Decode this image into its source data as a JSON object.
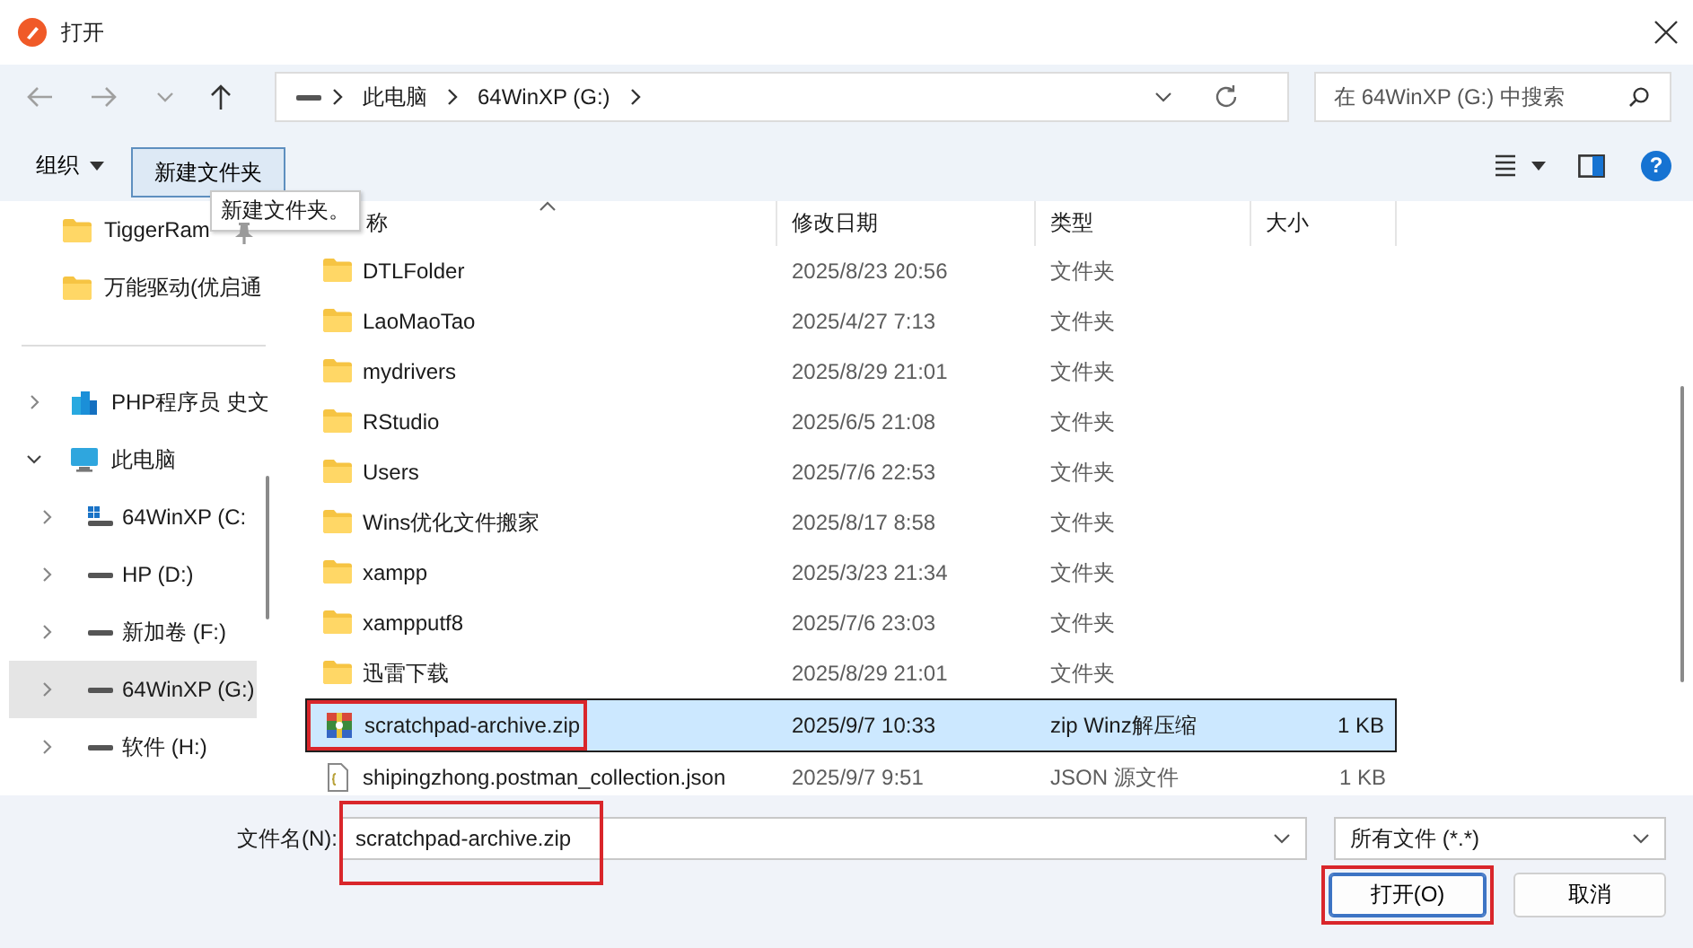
{
  "window": {
    "title": "打开"
  },
  "navigation": {
    "path": [
      "此电脑",
      "64WinXP (G:)"
    ],
    "search": {
      "placeholder": "在 64WinXP (G:) 中搜索"
    }
  },
  "toolbar": {
    "organize": "组织",
    "new_folder": {
      "label": "新建文件夹",
      "hovered": true
    },
    "tooltip": "新建文件夹。",
    "help": "?"
  },
  "sidebar": {
    "quick_access": [
      {
        "label": "TiggerRam",
        "pinned": true
      },
      {
        "label": "万能驱动(优启通",
        "pinned": false
      }
    ],
    "tree": [
      {
        "label": "PHP程序员 史文",
        "kind": "cloud",
        "expanded": false,
        "selected": false
      },
      {
        "label": "此电脑",
        "kind": "pc",
        "expanded": true,
        "selected": false,
        "children": [
          {
            "label": "64WinXP  (C:",
            "kind": "system",
            "expanded": false,
            "selected": false
          },
          {
            "label": "HP (D:)",
            "kind": "drive",
            "expanded": false,
            "selected": false
          },
          {
            "label": "新加卷 (F:)",
            "kind": "drive",
            "expanded": false,
            "selected": false
          },
          {
            "label": "64WinXP (G:)",
            "kind": "drive",
            "expanded": false,
            "selected": true
          },
          {
            "label": "软件 (H:)",
            "kind": "drive",
            "expanded": false,
            "selected": false
          }
        ]
      }
    ]
  },
  "file_list": {
    "columns": [
      {
        "label": "称",
        "sorted": true
      },
      {
        "label": "修改日期",
        "sorted": false
      },
      {
        "label": "类型",
        "sorted": false
      },
      {
        "label": "大小",
        "sorted": false
      }
    ],
    "rows": [
      {
        "name": "DTLFolder",
        "modified": "2025/8/23 20:56",
        "type": "文件夹",
        "kind": "folder",
        "selected": false,
        "highlighted": false
      },
      {
        "name": "LaoMaoTao",
        "modified": "2025/4/27 7:13",
        "type": "文件夹",
        "kind": "folder",
        "selected": false,
        "highlighted": false
      },
      {
        "name": "mydrivers",
        "modified": "2025/8/29 21:01",
        "type": "文件夹",
        "kind": "folder",
        "selected": false,
        "highlighted": false
      },
      {
        "name": "RStudio",
        "modified": "2025/6/5 21:08",
        "type": "文件夹",
        "kind": "folder",
        "selected": false,
        "highlighted": false
      },
      {
        "name": "Users",
        "modified": "2025/7/6 22:53",
        "type": "文件夹",
        "kind": "folder",
        "selected": false,
        "highlighted": false
      },
      {
        "name": "Wins优化文件搬家",
        "modified": "2025/8/17 8:58",
        "type": "文件夹",
        "kind": "folder",
        "selected": false,
        "highlighted": false
      },
      {
        "name": "xampp",
        "modified": "2025/3/23 21:34",
        "type": "文件夹",
        "kind": "folder",
        "selected": false,
        "highlighted": false
      },
      {
        "name": "xampputf8",
        "modified": "2025/7/6 23:03",
        "type": "文件夹",
        "kind": "folder",
        "selected": false,
        "highlighted": false
      },
      {
        "name": "迅雷下载",
        "modified": "2025/8/29 21:01",
        "type": "文件夹",
        "kind": "folder",
        "selected": false,
        "highlighted": false
      },
      {
        "name": "scratchpad-archive.zip",
        "modified": "2025/9/7 10:33",
        "type": "zip Winz解压缩",
        "size": "1 KB",
        "kind": "archive",
        "selected": true,
        "highlighted": true
      },
      {
        "name": "shipingzhong.postman_collection.json",
        "modified": "2025/9/7 9:51",
        "type": "JSON 源文件",
        "size": "1 KB",
        "kind": "json",
        "selected": false,
        "highlighted": false
      }
    ]
  },
  "footer": {
    "filename_label": "文件名(N):",
    "filename": {
      "value": "scratchpad-archive.zip",
      "highlighted": true
    },
    "filter": "所有文件 (*.*)",
    "buttons": [
      {
        "label": "打开(O)",
        "kind": "primary",
        "highlighted": true
      },
      {
        "label": "取消",
        "kind": "secondary",
        "highlighted": false
      }
    ]
  }
}
